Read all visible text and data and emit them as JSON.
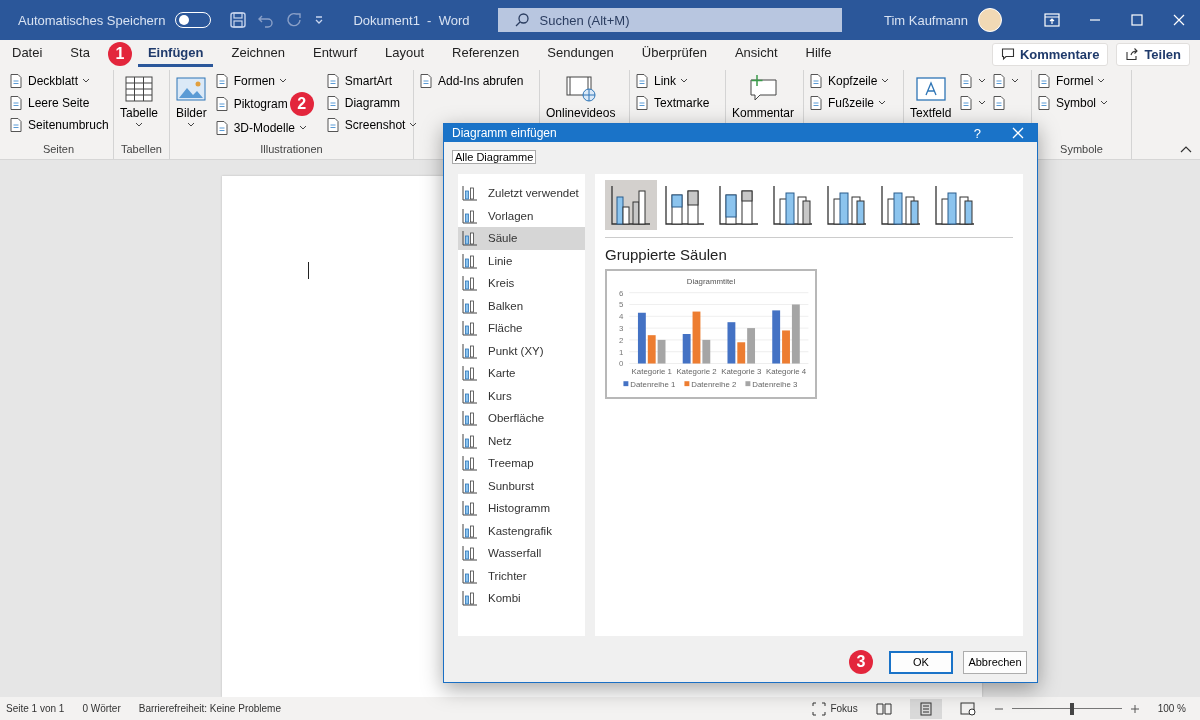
{
  "titlebar": {
    "autosave_label": "Automatisches Speichern",
    "autosave_on": false,
    "doc_title": "Dokument1  -  Word",
    "search": {
      "placeholder": "Suchen (Alt+M)"
    },
    "user": "Tim Kaufmann"
  },
  "tabs": [
    {
      "label": "Datei",
      "selected": false
    },
    {
      "label": "Sta",
      "selected": false
    },
    {
      "label": "Einfügen",
      "selected": true
    },
    {
      "label": "Zeichnen",
      "selected": false
    },
    {
      "label": "Entwurf",
      "selected": false
    },
    {
      "label": "Layout",
      "selected": false
    },
    {
      "label": "Referenzen",
      "selected": false
    },
    {
      "label": "Sendungen",
      "selected": false
    },
    {
      "label": "Überprüfen",
      "selected": false
    },
    {
      "label": "Ansicht",
      "selected": false
    },
    {
      "label": "Hilfe",
      "selected": false
    }
  ],
  "tab_actions": [
    "Kommentare",
    "Teilen"
  ],
  "ribbon": [
    {
      "label": "Seiten",
      "columns": [
        {
          "kind": "stack",
          "items": [
            {
              "label": "Deckblatt",
              "dropdown": true
            },
            {
              "label": "Leere Seite",
              "dropdown": false
            },
            {
              "label": "Seitenumbruch",
              "dropdown": false
            }
          ]
        }
      ]
    },
    {
      "label": "Tabellen",
      "columns": [
        {
          "kind": "large",
          "label": "Tabelle",
          "dropdown": true
        }
      ]
    },
    {
      "label": "Illustrationen",
      "columns": [
        {
          "kind": "large",
          "label": "Bilder",
          "dropdown": true
        },
        {
          "kind": "stack",
          "items": [
            {
              "label": "Formen",
              "dropdown": true
            },
            {
              "label": "Piktogram",
              "dropdown": false
            },
            {
              "label": "3D-Modelle",
              "dropdown": true
            }
          ]
        },
        {
          "kind": "stack",
          "items": [
            {
              "label": "SmartArt",
              "dropdown": false
            },
            {
              "label": "Diagramm",
              "dropdown": false
            },
            {
              "label": "Screenshot",
              "dropdown": true
            }
          ]
        }
      ]
    },
    {
      "columns": [
        {
          "kind": "stack",
          "items": [
            {
              "label": "Add-Ins abrufen",
              "dropdown": false
            }
          ]
        }
      ]
    },
    {
      "columns": [
        {
          "kind": "large",
          "label": "Onlinevideos",
          "dropdown": false
        }
      ]
    },
    {
      "columns": [
        {
          "kind": "stack",
          "items": [
            {
              "label": "Link",
              "dropdown": true
            },
            {
              "label": "Textmarke",
              "dropdown": false
            }
          ]
        }
      ]
    },
    {
      "columns": [
        {
          "kind": "large",
          "label": "Kommentar",
          "dropdown": false
        }
      ]
    },
    {
      "columns": [
        {
          "kind": "stack",
          "items": [
            {
              "label": "Kopfzeile",
              "dropdown": true
            },
            {
              "label": "Fußzeile",
              "dropdown": true
            }
          ]
        }
      ]
    },
    {
      "columns": [
        {
          "kind": "large",
          "label": "Textfeld",
          "dropdown": false
        },
        {
          "kind": "stack",
          "items": [
            {
              "dropdown": true
            },
            {
              "dropdown": true
            }
          ]
        },
        {
          "kind": "stack",
          "items": [
            {
              "dropdown": true
            },
            {
              "dropdown": false
            }
          ]
        }
      ]
    },
    {
      "label": "Symbole",
      "columns": [
        {
          "kind": "stack",
          "items": [
            {
              "label": "Formel",
              "dropdown": true
            },
            {
              "label": "Symbol",
              "dropdown": true
            }
          ]
        }
      ]
    }
  ],
  "dialog": {
    "title": "Diagramm einfügen",
    "help": "?",
    "tab": "Alle Diagramme",
    "chart_types": [
      {
        "label": "Zuletzt verwendet",
        "selected": false
      },
      {
        "label": "Vorlagen",
        "selected": false
      },
      {
        "label": "Säule",
        "selected": true
      },
      {
        "label": "Linie",
        "selected": false
      },
      {
        "label": "Kreis",
        "selected": false
      },
      {
        "label": "Balken",
        "selected": false
      },
      {
        "label": "Fläche",
        "selected": false
      },
      {
        "label": "Punkt (XY)",
        "selected": false
      },
      {
        "label": "Karte",
        "selected": false
      },
      {
        "label": "Kurs",
        "selected": false
      },
      {
        "label": "Oberfläche",
        "selected": false
      },
      {
        "label": "Netz",
        "selected": false
      },
      {
        "label": "Treemap",
        "selected": false
      },
      {
        "label": "Sunburst",
        "selected": false
      },
      {
        "label": "Histogramm",
        "selected": false
      },
      {
        "label": "Kastengrafik",
        "selected": false
      },
      {
        "label": "Wasserfall",
        "selected": false
      },
      {
        "label": "Trichter",
        "selected": false
      },
      {
        "label": "Kombi",
        "selected": false
      }
    ],
    "subtypes": [
      {
        "selected": true
      },
      {
        "selected": false
      },
      {
        "selected": false
      },
      {
        "selected": false
      },
      {
        "selected": false
      },
      {
        "selected": false
      },
      {
        "selected": false
      }
    ],
    "subtype_title": "Gruppierte Säulen",
    "preview": {
      "chart_data": {
        "type": "bar",
        "title": "Diagrammtitel",
        "categories": [
          "Kategorie 1",
          "Kategorie 2",
          "Kategorie 3",
          "Kategorie 4"
        ],
        "series": [
          {
            "name": "Datenreihe 1",
            "color": "#4472c4",
            "values": [
              4.3,
              2.5,
              3.5,
              4.5
            ]
          },
          {
            "name": "Datenreihe 2",
            "color": "#ed7d31",
            "values": [
              2.4,
              4.4,
              1.8,
              2.8
            ]
          },
          {
            "name": "Datenreihe 3",
            "color": "#a5a5a5",
            "values": [
              2,
              2,
              3,
              5
            ]
          }
        ],
        "ylim": [
          0,
          6
        ],
        "yticks": [
          0,
          1,
          2,
          3,
          4,
          5,
          6
        ],
        "grid": true,
        "legend": "bottom"
      }
    },
    "buttons": [
      "OK",
      "Abbrechen"
    ]
  },
  "callouts": [
    "1",
    "2",
    "3"
  ],
  "status_bar": {
    "left": [
      "Seite 1 von 1",
      "0 Wörter",
      "Barrierefreiheit: Keine Probleme"
    ],
    "focus": "Fokus",
    "zoom": {
      "level": 0.55
    },
    "zoom_label": "100 %"
  }
}
